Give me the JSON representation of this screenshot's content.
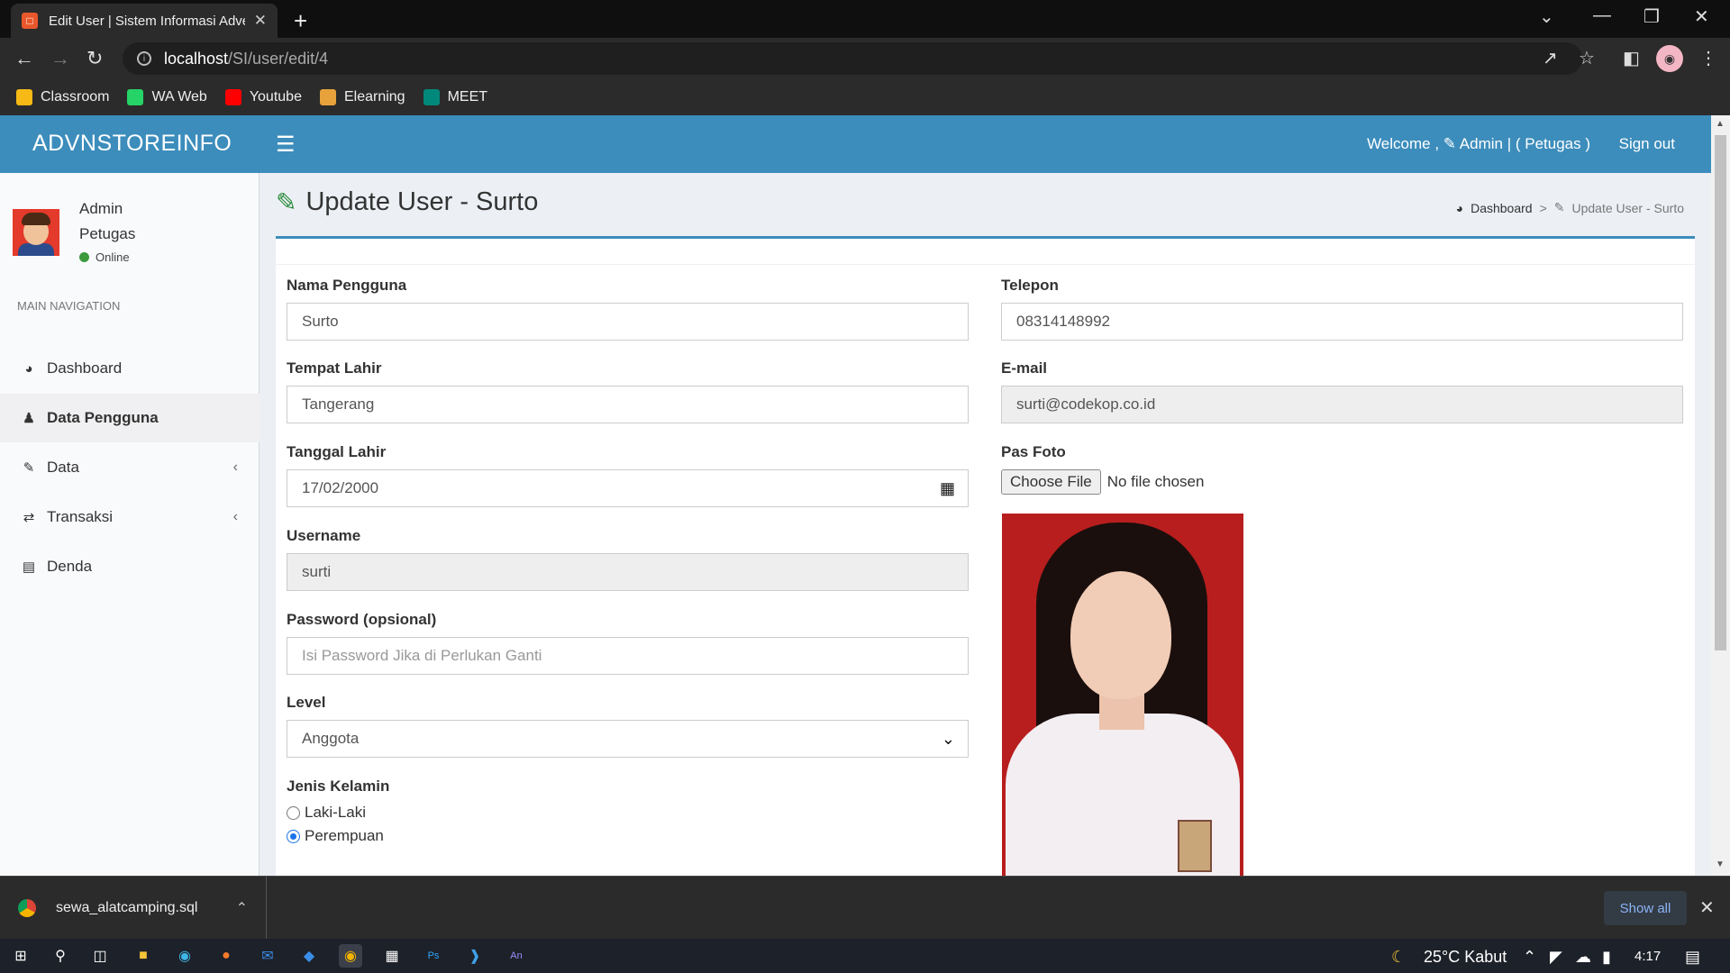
{
  "browser": {
    "tab_title": "Edit User | Sistem Informasi Adve",
    "url_host": "localhost",
    "url_path": "/SI/user/edit/4",
    "bookmarks": [
      {
        "label": "Classroom",
        "icon": "classroom-icon",
        "color": "#f6b915"
      },
      {
        "label": "WA Web",
        "icon": "whatsapp-icon",
        "color": "#25d366"
      },
      {
        "label": "Youtube",
        "icon": "youtube-icon",
        "color": "#ff0000"
      },
      {
        "label": "Elearning",
        "icon": "elearning-icon",
        "color": "#e8a23b"
      },
      {
        "label": "MEET",
        "icon": "meet-icon",
        "color": "#00897b"
      }
    ]
  },
  "header": {
    "logo": "ADVNSTOREINFO",
    "welcome": "Welcome , ✎ Admin | ( Petugas )",
    "signout": "Sign out",
    "color": "#3c8dbc"
  },
  "sidebar": {
    "user_name": "Admin",
    "user_role": "Petugas",
    "status": "Online",
    "nav_header": "MAIN NAVIGATION",
    "items": [
      {
        "label": "Dashboard",
        "icon": "dashboard-icon"
      },
      {
        "label": "Data Pengguna",
        "icon": "user-icon"
      },
      {
        "label": "Data",
        "icon": "edit-icon"
      },
      {
        "label": "Transaksi",
        "icon": "exchange-icon"
      },
      {
        "label": "Denda",
        "icon": "money-icon"
      }
    ]
  },
  "page": {
    "title": "Update User - Surto",
    "breadcrumb_home": "Dashboard",
    "breadcrumb_current": "Update User - Surto"
  },
  "form": {
    "nama_label": "Nama Pengguna",
    "nama_value": "Surto",
    "tempat_label": "Tempat Lahir",
    "tempat_value": "Tangerang",
    "tanggal_label": "Tanggal Lahir",
    "tanggal_value": "17/02/2000",
    "username_label": "Username",
    "username_value": "surti",
    "password_label": "Password (opsional)",
    "password_placeholder": "Isi Password Jika di Perlukan Ganti",
    "level_label": "Level",
    "level_value": "Anggota",
    "gender_label": "Jenis Kelamin",
    "gender_options": [
      "Laki-Laki",
      "Perempuan"
    ],
    "gender_selected": "Perempuan",
    "telepon_label": "Telepon",
    "telepon_value": "08314148992",
    "email_label": "E-mail",
    "email_value": "surti@codekop.co.id",
    "foto_label": "Pas Foto",
    "file_button": "Choose File",
    "file_status": "No file chosen"
  },
  "downloads": {
    "file": "sewa_alatcamping.sql",
    "show_all": "Show all"
  },
  "taskbar": {
    "weather": "25°C  Kabut",
    "time": "4:17"
  }
}
